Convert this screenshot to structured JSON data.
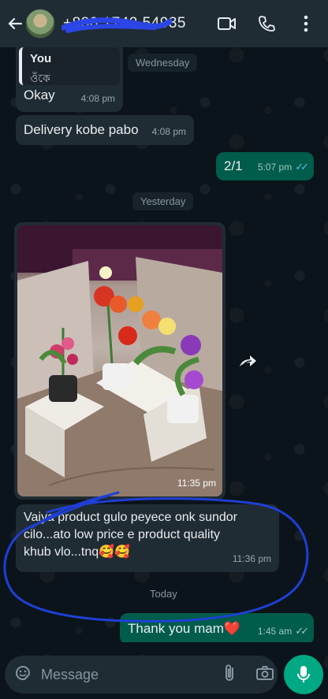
{
  "header": {
    "contact_name": "+880 1742 54935"
  },
  "messages": {
    "reply_quote_name": "You",
    "reply_quote_text": "ওঁকে",
    "okay_text": "Okay",
    "okay_time": "4:08 pm",
    "delivery_text": "Delivery kobe pabo",
    "delivery_time": "4:08 pm",
    "out1_text": "2/1",
    "out1_time": "5:07 pm",
    "photo_time": "11:35 pm",
    "review_line1": "Vaiya product gulo peyece onk sundor",
    "review_line2": "cilo...ato low price e product quality",
    "review_line3": "khub vlo...tnq🥰🥰",
    "review_time": "11:36 pm",
    "out2_text": "Thank you mam❤️",
    "out2_time": "1:45 am"
  },
  "day_chips": {
    "wednesday": "Wednesday",
    "yesterday": "Yesterday",
    "today": "Today"
  },
  "composer": {
    "placeholder": "Message"
  },
  "colors": {
    "header_bg": "#1f2c34",
    "incoming_bubble": "#202c33",
    "outgoing_bubble": "#005c4b",
    "read_ticks": "#53bdeb",
    "mic_button": "#00a884",
    "annotation_ink": "#1f3fd6"
  },
  "icons": [
    "back-arrow-icon",
    "video-call-icon",
    "voice-call-icon",
    "more-menu-icon",
    "forward-icon",
    "sticker-icon",
    "attach-icon",
    "camera-icon",
    "mic-icon"
  ]
}
